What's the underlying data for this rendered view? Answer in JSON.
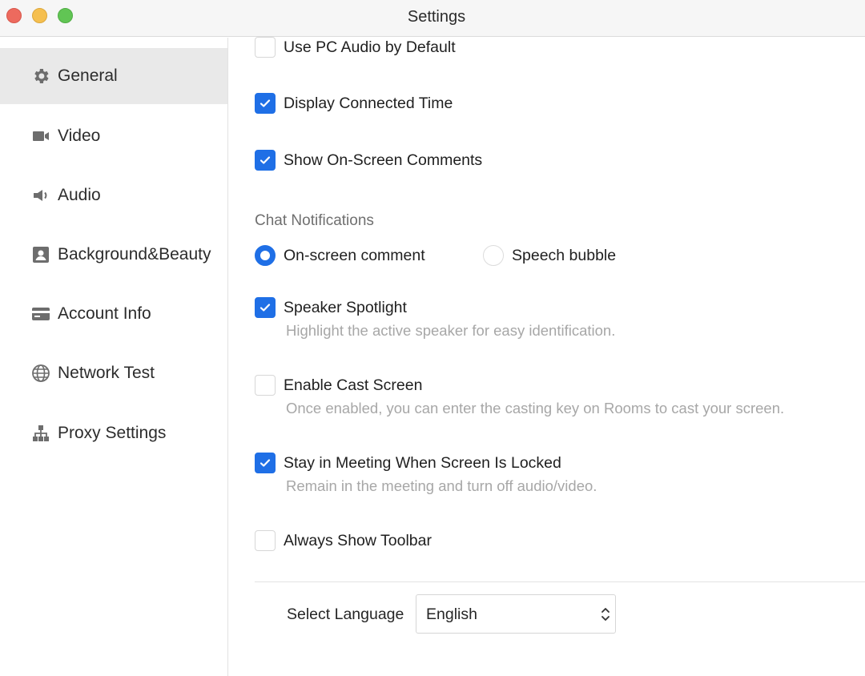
{
  "window": {
    "title": "Settings"
  },
  "sidebar": {
    "items": [
      {
        "label": "General",
        "icon": "gear-icon",
        "active": true
      },
      {
        "label": "Video",
        "icon": "video-camera-icon",
        "active": false
      },
      {
        "label": "Audio",
        "icon": "speaker-icon",
        "active": false
      },
      {
        "label": "Background&Beauty",
        "icon": "portrait-icon",
        "active": false
      },
      {
        "label": "Account Info",
        "icon": "card-icon",
        "active": false
      },
      {
        "label": "Network Test",
        "icon": "globe-icon",
        "active": false
      },
      {
        "label": "Proxy Settings",
        "icon": "network-tree-icon",
        "active": false
      }
    ]
  },
  "general": {
    "use_pc_audio": {
      "label": "Use PC Audio by Default",
      "checked": false
    },
    "display_connected_time": {
      "label": "Display Connected Time",
      "checked": true
    },
    "show_onscreen_comments": {
      "label": "Show On-Screen Comments",
      "checked": true
    },
    "chat_notifications": {
      "title": "Chat Notifications",
      "options": [
        {
          "label": "On-screen comment",
          "selected": true
        },
        {
          "label": "Speech bubble",
          "selected": false
        }
      ]
    },
    "speaker_spotlight": {
      "label": "Speaker Spotlight",
      "checked": true,
      "description": "Highlight the active speaker for easy identification."
    },
    "enable_cast_screen": {
      "label": "Enable Cast Screen",
      "checked": false,
      "description": "Once enabled, you can enter the casting key on Rooms to cast your screen."
    },
    "stay_in_meeting": {
      "label": "Stay in Meeting When Screen Is Locked",
      "checked": true,
      "description": "Remain in the meeting and turn off audio/video."
    },
    "always_show_toolbar": {
      "label": "Always Show Toolbar",
      "checked": false
    },
    "language": {
      "label": "Select Language",
      "value": "English"
    }
  },
  "colors": {
    "accent": "#1f6fe6",
    "sidebar_active_bg": "#e9e9e9",
    "description_text": "#a7a7a7"
  }
}
